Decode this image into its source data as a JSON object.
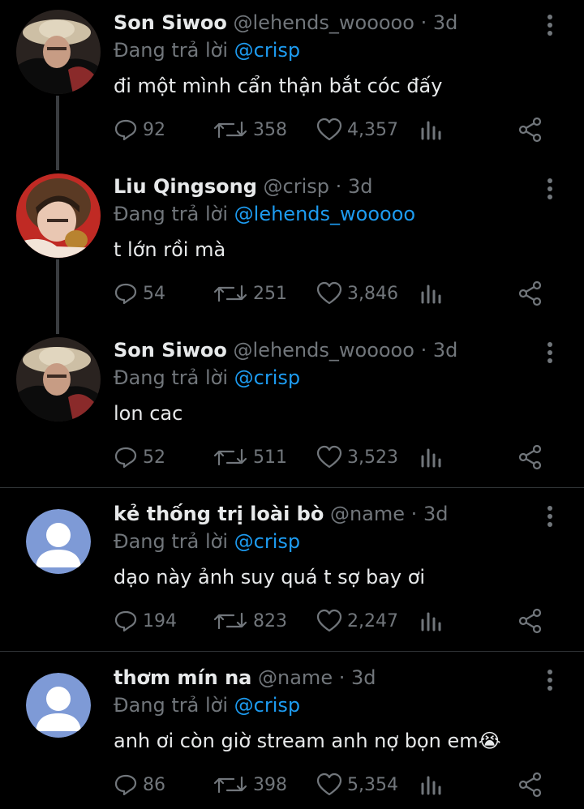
{
  "tweets": [
    {
      "name": "Son Siwoo",
      "handle": "@lehends_wooooo",
      "time": "3d",
      "reply_prefix": "Đang trả lời",
      "reply_to": "@crisp",
      "text": "đi một mình cẩn thận bắt cóc đấy",
      "replies": "92",
      "retweets": "358",
      "likes": "4,357",
      "avatar": "photo-1"
    },
    {
      "name": "Liu Qingsong",
      "handle": "@crisp",
      "time": "3d",
      "reply_prefix": "Đang trả lời",
      "reply_to": "@lehends_wooooo",
      "text": "t lớn rồi mà",
      "replies": "54",
      "retweets": "251",
      "likes": "3,846",
      "avatar": "photo-2"
    },
    {
      "name": "Son Siwoo",
      "handle": "@lehends_wooooo",
      "time": "3d",
      "reply_prefix": "Đang trả lời",
      "reply_to": "@crisp",
      "text": "lon cac",
      "replies": "52",
      "retweets": "511",
      "likes": "3,523",
      "avatar": "photo-1"
    },
    {
      "name": "kẻ thống trị loài bò",
      "handle": "@name",
      "time": "3d",
      "reply_prefix": "Đang trả lời",
      "reply_to": "@crisp",
      "text": "dạo này ảnh suy quá t sợ bay ơi",
      "replies": "194",
      "retweets": "823",
      "likes": "2,247",
      "avatar": "default"
    },
    {
      "name": "thơm mín na",
      "handle": "@name",
      "time": "3d",
      "reply_prefix": "Đang trả lời",
      "reply_to": "@crisp",
      "text": "anh ơi còn giờ stream anh nợ bọn em",
      "emoji": "😭",
      "replies": "86",
      "retweets": "398",
      "likes": "5,354",
      "avatar": "default"
    }
  ],
  "colors": {
    "background": "#000000",
    "text": "#e7e9ea",
    "muted": "#71767b",
    "link": "#1d9bf0",
    "thread_line": "#3a3d40",
    "divider": "#2f3336",
    "default_avatar": "#7e9ad6"
  },
  "icons": {
    "reply": "reply-icon",
    "retweet": "retweet-icon",
    "like": "heart-icon",
    "stats": "stats-icon",
    "share": "share-icon",
    "more": "more-options-icon"
  }
}
